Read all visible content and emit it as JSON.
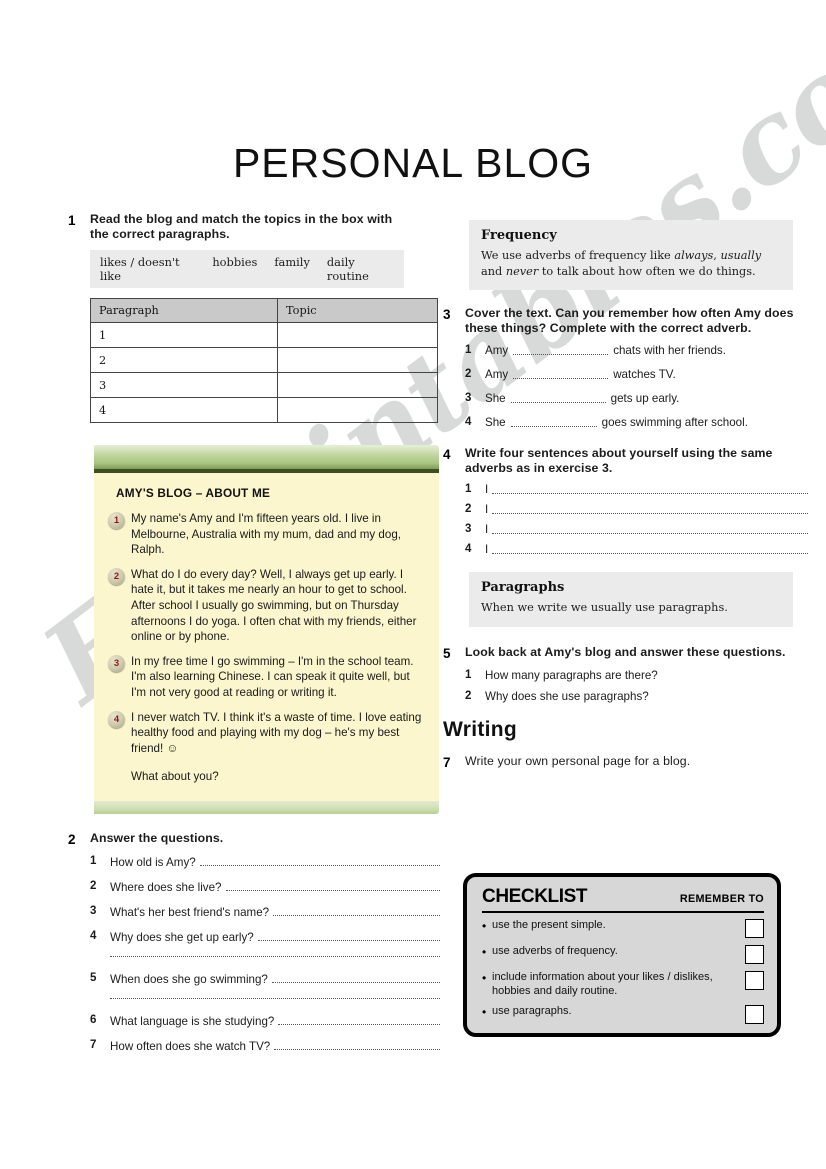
{
  "title": "PERSONAL BLOG",
  "watermark": "EslPrintables.com",
  "exercise1": {
    "number": "1",
    "instruction": "Read the blog and match the topics in the box with the correct paragraphs.",
    "topics": [
      "likes / doesn't like",
      "hobbies",
      "family",
      "daily routine"
    ],
    "table": {
      "headers": [
        "Paragraph",
        "Topic"
      ],
      "rows": [
        {
          "paragraph": "1",
          "topic": ""
        },
        {
          "paragraph": "2",
          "topic": ""
        },
        {
          "paragraph": "3",
          "topic": ""
        },
        {
          "paragraph": "4",
          "topic": ""
        }
      ]
    }
  },
  "blog": {
    "heading": "AMY'S BLOG – ABOUT ME",
    "paragraphs": [
      {
        "n": "1",
        "text": "My name's Amy and I'm fifteen years old. I live in Melbourne, Australia with my mum, dad and my dog, Ralph."
      },
      {
        "n": "2",
        "text": "What do I do every day? Well, I always get up early. I hate it, but it takes me nearly an hour to get to school. After school I usually go swimming, but on Thursday afternoons I do yoga. I often chat with my friends, either online or by phone."
      },
      {
        "n": "3",
        "text": "In my free time I go swimming – I'm in the school team. I'm also learning Chinese. I can speak it quite well, but I'm not very good at reading or writing it."
      },
      {
        "n": "4",
        "text": "I never watch TV. I think it's a waste of time. I love eating healthy food and playing with my dog – he's my best friend!  ☺"
      }
    ],
    "closing": "What about you?"
  },
  "exercise2": {
    "number": "2",
    "instruction": "Answer the questions.",
    "questions": [
      {
        "n": "1",
        "text": "How old is Amy?",
        "extra_line": false
      },
      {
        "n": "2",
        "text": "Where does she live?",
        "extra_line": false
      },
      {
        "n": "3",
        "text": "What's her best friend's name?",
        "extra_line": false
      },
      {
        "n": "4",
        "text": "Why does she get up early?",
        "extra_line": true
      },
      {
        "n": "5",
        "text": "When does she go swimming?",
        "extra_line": true
      },
      {
        "n": "6",
        "text": "What language is she studying?",
        "extra_line": false
      },
      {
        "n": "7",
        "text": "How often does she watch TV?",
        "extra_line": false
      }
    ]
  },
  "frequency_box": {
    "title": "Frequency",
    "text_1": "We use adverbs of frequency like ",
    "em_1": "always",
    "text_2": ", ",
    "em_2": "usually",
    "text_3": " and ",
    "em_3": "never",
    "text_4": " to talk about how often we do things."
  },
  "exercise3": {
    "number": "3",
    "instruction": "Cover the text. Can you remember how often Amy does these things? Complete with the correct adverb.",
    "items": [
      {
        "n": "1",
        "before": "Amy",
        "after": "chats with her friends."
      },
      {
        "n": "2",
        "before": "Amy",
        "after": "watches TV."
      },
      {
        "n": "3",
        "before": "She",
        "after": "gets up early."
      },
      {
        "n": "4",
        "before": "She",
        "after": "goes swimming after school."
      }
    ]
  },
  "exercise4": {
    "number": "4",
    "instruction": "Write four sentences about yourself using the same adverbs as in exercise 3.",
    "items": [
      {
        "n": "1",
        "prefix": "I"
      },
      {
        "n": "2",
        "prefix": "I"
      },
      {
        "n": "3",
        "prefix": "I"
      },
      {
        "n": "4",
        "prefix": "I"
      }
    ]
  },
  "paragraphs_box": {
    "title": "Paragraphs",
    "text": "When we write we usually use paragraphs."
  },
  "exercise5": {
    "number": "5",
    "instruction": "Look back at Amy's blog and answer these questions.",
    "questions": [
      {
        "n": "1",
        "text": "How many paragraphs are there?"
      },
      {
        "n": "2",
        "text": "Why does she use paragraphs?"
      }
    ]
  },
  "writing": {
    "heading": "Writing",
    "number": "7",
    "instruction": "Write your own personal page for a blog."
  },
  "checklist": {
    "title": "CHECKLIST",
    "remember": "REMEMBER TO",
    "items": [
      {
        "text": "use the present simple."
      },
      {
        "text": "use adverbs of frequency."
      },
      {
        "text": "include information about your likes / dislikes, hobbies and daily routine."
      },
      {
        "text": "use paragraphs."
      }
    ]
  },
  "colors": {
    "blog_body": "#fbf6cd",
    "blog_bar": "#a8c682",
    "infobox": "#ebebeb",
    "table_header": "#c9c9c9",
    "checklist_bg": "#d7d7d7",
    "badge_text": "#8d1a1a"
  }
}
